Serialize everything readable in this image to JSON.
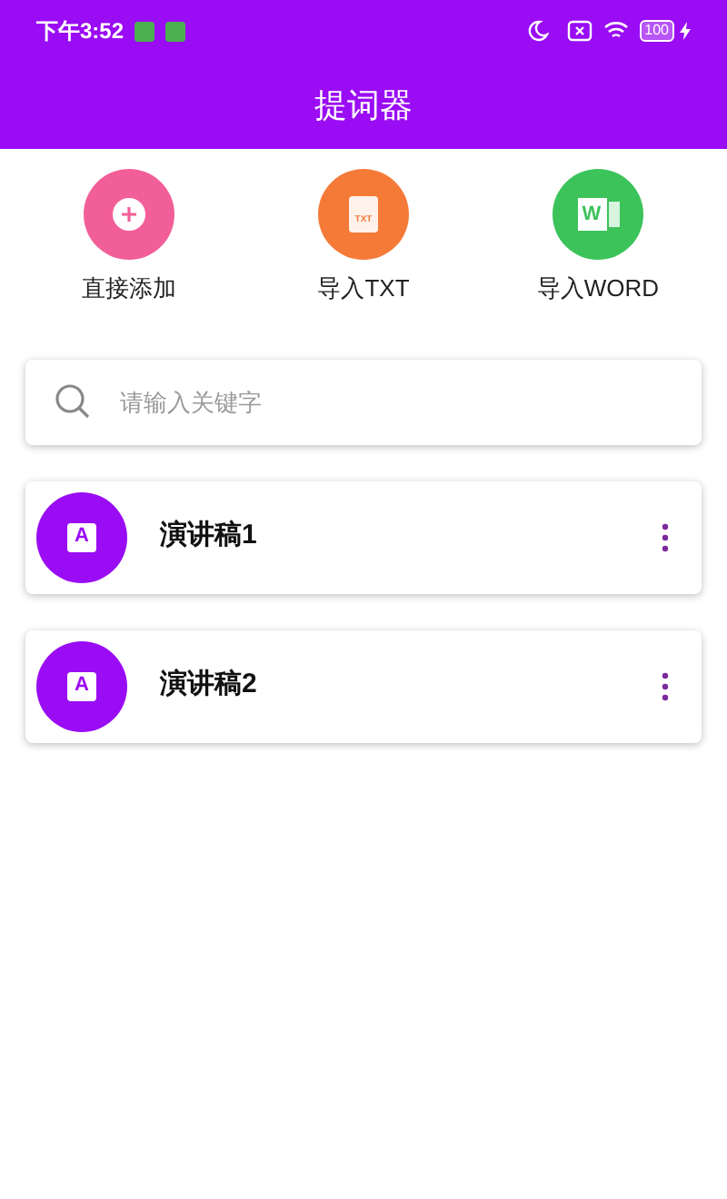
{
  "status_bar": {
    "time": "下午3:52",
    "battery": "100"
  },
  "header": {
    "title": "提词器"
  },
  "actions": [
    {
      "kind": "add",
      "label": "直接添加",
      "color": "#f25f98"
    },
    {
      "kind": "txt",
      "label": "导入TXT",
      "icon_text": "TXT",
      "color": "#f57a38"
    },
    {
      "kind": "word",
      "label": "导入WORD",
      "icon_text": "W",
      "color": "#3cc35a"
    }
  ],
  "search": {
    "placeholder": "请输入关键字"
  },
  "scripts": [
    {
      "title": "演讲稿1",
      "icon_text": "A"
    },
    {
      "title": "演讲稿2",
      "icon_text": "A"
    }
  ]
}
